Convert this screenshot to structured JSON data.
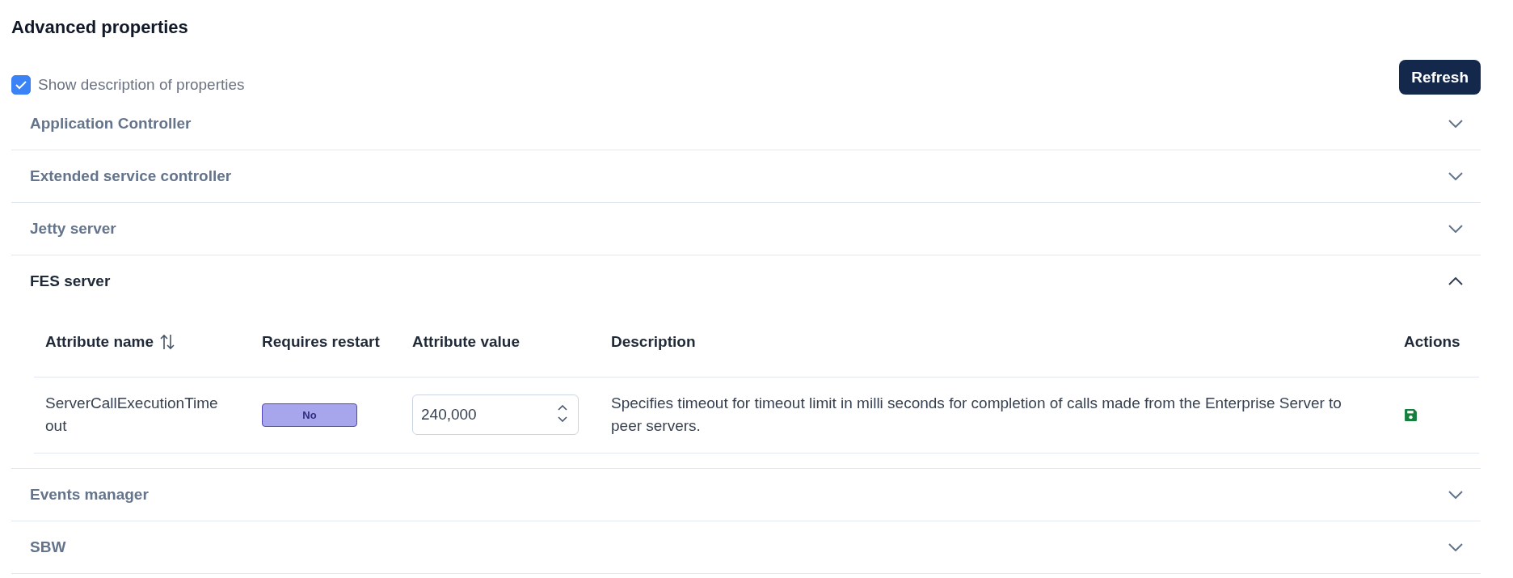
{
  "title": "Advanced properties",
  "show_description": {
    "label": "Show description of properties",
    "checked": true
  },
  "refresh_button": "Refresh",
  "sections": [
    {
      "title": "Application Controller",
      "expanded": false
    },
    {
      "title": "Extended service controller",
      "expanded": false
    },
    {
      "title": "Jetty server",
      "expanded": false
    },
    {
      "title": "FES server",
      "expanded": true,
      "table": {
        "columns": [
          {
            "label": "Attribute name",
            "sortable": true
          },
          {
            "label": "Requires restart",
            "sortable": false
          },
          {
            "label": "Attribute value",
            "sortable": false
          },
          {
            "label": "Description",
            "sortable": false
          },
          {
            "label": "Actions",
            "sortable": false
          }
        ],
        "rows": [
          {
            "name": "ServerCallExecutionTimeout",
            "requires_restart": "No",
            "value": "240,000",
            "description": "Specifies timeout for timeout limit in milli seconds for completion of calls made from the Enterprise Server to peer servers."
          }
        ]
      }
    },
    {
      "title": "Events manager",
      "expanded": false
    },
    {
      "title": "SBW",
      "expanded": false
    }
  ]
}
